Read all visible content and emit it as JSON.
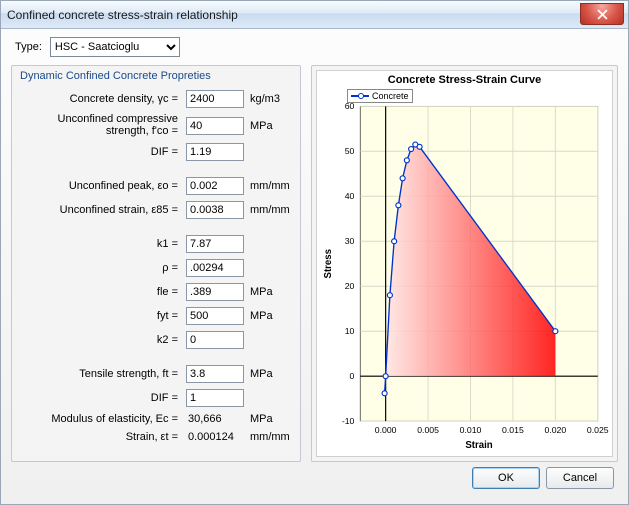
{
  "window": {
    "title": "Confined concrete stress-strain relationship"
  },
  "type_row": {
    "label": "Type:",
    "selected": "HSC - Saatcioglu"
  },
  "group": {
    "title": "Dynamic Confined Concrete Propreties"
  },
  "fields": {
    "yc": {
      "label": "Concrete density, γc =",
      "value": "2400",
      "unit": "kg/m3",
      "editable": true
    },
    "fco": {
      "label": "Unconfined compressive strength, f'co =",
      "value": "40",
      "unit": "MPa",
      "editable": true
    },
    "dif": {
      "label": "DIF =",
      "value": "1.19",
      "unit": "",
      "editable": true
    },
    "eo": {
      "label": "Unconfined peak, εo =",
      "value": "0.002",
      "unit": "mm/mm",
      "editable": true
    },
    "e85": {
      "label": "Unconfined strain, ε85 =",
      "value": "0.0038",
      "unit": "mm/mm",
      "editable": true
    },
    "k1": {
      "label": "k1 =",
      "value": "7.87",
      "unit": "",
      "editable": true
    },
    "p": {
      "label": "ρ =",
      "value": ".00294",
      "unit": "",
      "editable": true
    },
    "fle": {
      "label": "fle =",
      "value": ".389",
      "unit": "MPa",
      "editable": true
    },
    "fyt": {
      "label": "fyt =",
      "value": "500",
      "unit": "MPa",
      "editable": true
    },
    "k2": {
      "label": "k2 =",
      "value": "0",
      "unit": "",
      "editable": true
    },
    "ft": {
      "label": "Tensile strength, ft =",
      "value": "3.8",
      "unit": "MPa",
      "editable": true
    },
    "dif2": {
      "label": "DIF =",
      "value": "1",
      "unit": "",
      "editable": true
    },
    "ec": {
      "label": "Modulus of elasticity, Ec =",
      "value": "30,666",
      "unit": "MPa",
      "editable": false
    },
    "et": {
      "label": "Strain, εt =",
      "value": "0.000124",
      "unit": "mm/mm",
      "editable": false
    }
  },
  "chart_data": {
    "type": "line",
    "title": "Concrete Stress-Strain Curve",
    "xlabel": "Strain",
    "ylabel": "Stress",
    "xlim": [
      -0.003,
      0.025
    ],
    "ylim": [
      -10,
      60
    ],
    "xticks": [
      0.0,
      0.005,
      0.01,
      0.015,
      0.02,
      0.025
    ],
    "yticks": [
      -10,
      0,
      10,
      20,
      30,
      40,
      50,
      60
    ],
    "series": [
      {
        "name": "Concrete",
        "color": "#0033cc",
        "fill_color_start": "#ffe5e5",
        "fill_color_end": "#ff0000",
        "x": [
          -0.000124,
          0.0,
          0.0005,
          0.001,
          0.0015,
          0.002,
          0.0025,
          0.003,
          0.0035,
          0.004,
          0.02
        ],
        "y": [
          -3.8,
          0.0,
          18.0,
          30.0,
          38.0,
          44.0,
          48.0,
          50.5,
          51.5,
          51.0,
          10.0
        ]
      }
    ]
  },
  "footer": {
    "ok": "OK",
    "cancel": "Cancel"
  }
}
